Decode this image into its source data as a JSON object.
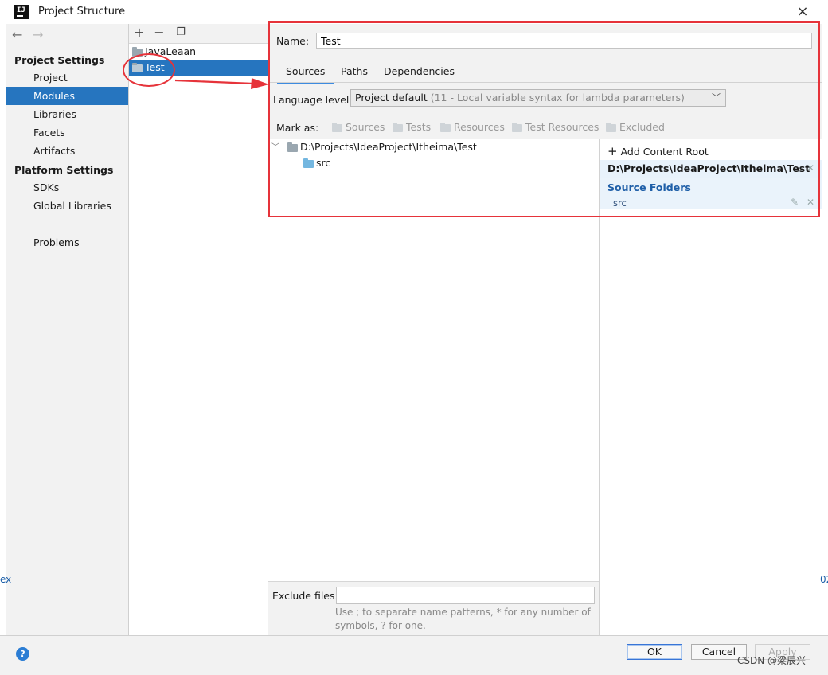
{
  "window": {
    "title": "Project Structure",
    "close_glyph": "×",
    "app_icon_text": "IJ"
  },
  "nav": {
    "back_glyph": "←",
    "forward_glyph": "→"
  },
  "left_panel": {
    "project_settings_title": "Project Settings",
    "project_settings_items": [
      "Project",
      "Modules",
      "Libraries",
      "Facets",
      "Artifacts"
    ],
    "selected_item": "Modules",
    "platform_settings_title": "Platform Settings",
    "platform_settings_items": [
      "SDKs",
      "Global Libraries"
    ],
    "problems_label": "Problems"
  },
  "module_toolbar": {
    "add_glyph": "+",
    "remove_glyph": "−",
    "copy_glyph": "❐"
  },
  "modules": [
    "JavaLeaan",
    "Test"
  ],
  "selected_module": "Test",
  "main": {
    "name_label": "Name:",
    "name_value": "Test",
    "tabs": [
      "Sources",
      "Paths",
      "Dependencies"
    ],
    "active_tab": "Sources",
    "language_level_label": "Language level:",
    "language_level_value": "Project default",
    "language_level_hint": "(11 - Local variable syntax for lambda parameters)",
    "mark_as_label": "Mark as:",
    "mark_as_options": [
      "Sources",
      "Tests",
      "Resources",
      "Test Resources",
      "Excluded"
    ],
    "tree": {
      "root": "D:\\Projects\\IdeaProject\\Itheima\\Test",
      "child": "src"
    },
    "exclude_files_label": "Exclude files:",
    "exclude_files_value": "",
    "exclude_files_hint": "Use ; to separate name patterns, * for any number of symbols, ? for one."
  },
  "content_root": {
    "add_label": "Add Content Root",
    "root_path": "D:\\Projects\\IdeaProject\\Itheima\\Test",
    "source_folders_title": "Source Folders",
    "source_folder": "src"
  },
  "buttons": {
    "help": "?",
    "ok": "OK",
    "cancel": "Cancel",
    "apply": "Apply"
  },
  "watermark": "CSDN @梁辰兴",
  "edge_glyphs": {
    "left": "ex",
    "right": "02"
  },
  "colors": {
    "selection": "#2675bf",
    "annotation_red": "#e6333a",
    "link_blue": "#1f5fa8"
  }
}
